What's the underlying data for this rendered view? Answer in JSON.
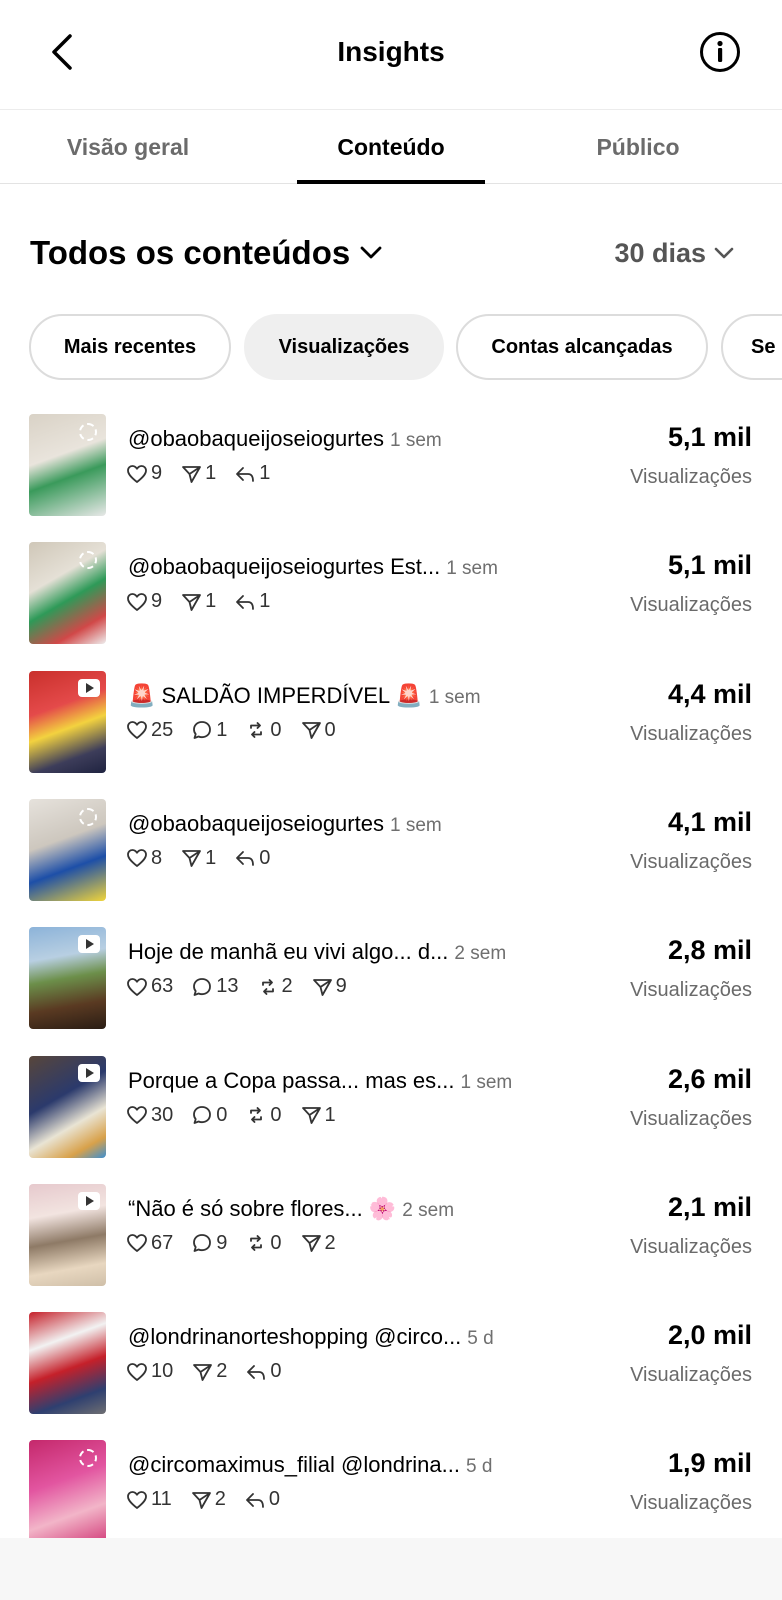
{
  "header": {
    "title": "Insights"
  },
  "tabs": [
    {
      "label": "Visão geral"
    },
    {
      "label": "Conteúdo"
    },
    {
      "label": "Público"
    }
  ],
  "filter": {
    "title": "Todos os conteúdos",
    "period": "30 dias"
  },
  "chips": [
    {
      "label": "Mais recentes"
    },
    {
      "label": "Visualizações"
    },
    {
      "label": "Contas alcançadas"
    },
    {
      "label": "Se"
    }
  ],
  "posts": [
    {
      "title": "@obaobaqueijoseiogurtes",
      "age": "1 sem",
      "stats": [
        "9",
        "1",
        "1"
      ],
      "views": "5,1 mil",
      "views_label": "Visualizações"
    },
    {
      "title": "@obaobaqueijoseiogurtes  Est...",
      "age": "1 sem",
      "stats": [
        "9",
        "1",
        "1"
      ],
      "views": "5,1 mil",
      "views_label": "Visualizações"
    },
    {
      "title": "🚨 SALDÃO IMPERDÍVEL 🚨",
      "age": "1 sem",
      "stats": [
        "25",
        "1",
        "0",
        "0"
      ],
      "views": "4,4 mil",
      "views_label": "Visualizações"
    },
    {
      "title": "@obaobaqueijoseiogurtes",
      "age": "1 sem",
      "stats": [
        "8",
        "1",
        "0"
      ],
      "views": "4,1 mil",
      "views_label": "Visualizações"
    },
    {
      "title": "Hoje de manhã eu vivi algo... d...",
      "age": "2 sem",
      "stats": [
        "63",
        "13",
        "2",
        "9"
      ],
      "views": "2,8 mil",
      "views_label": "Visualizações"
    },
    {
      "title": "Porque a Copa passa... mas es...",
      "age": "1 sem",
      "stats": [
        "30",
        "0",
        "0",
        "1"
      ],
      "views": "2,6 mil",
      "views_label": "Visualizações"
    },
    {
      "title": "“Não é só sobre flores... 🌸",
      "age": "2 sem",
      "stats": [
        "67",
        "9",
        "0",
        "2"
      ],
      "views": "2,1 mil",
      "views_label": "Visualizações"
    },
    {
      "title": "@londrinanorteshopping  @circo...",
      "age": "5 d",
      "stats": [
        "10",
        "2",
        "0"
      ],
      "views": "2,0 mil",
      "views_label": "Visualizações"
    },
    {
      "title": "@circomaximus_filial  @londrina...",
      "age": "5 d",
      "stats": [
        "11",
        "2",
        "0"
      ],
      "views": "1,9 mil",
      "views_label": "Visualizações"
    }
  ]
}
